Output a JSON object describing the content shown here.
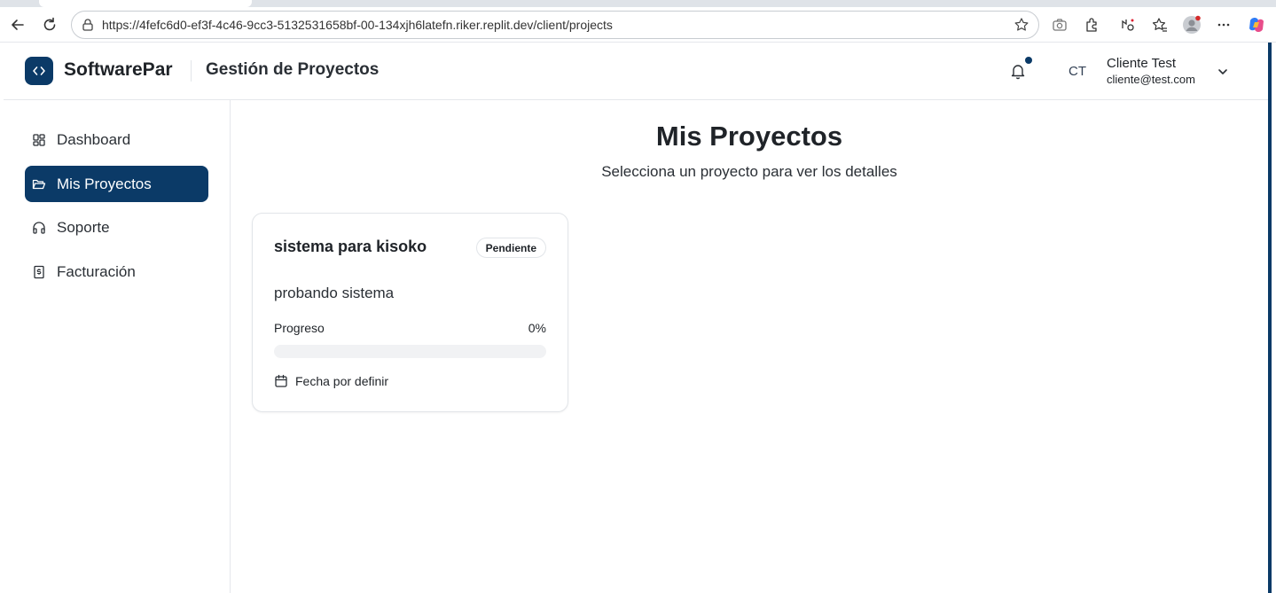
{
  "browser": {
    "url": "https://4fefc6d0-ef3f-4c46-9cc3-5132531658bf-00-134xjh6latefn.riker.replit.dev/client/projects"
  },
  "header": {
    "brand": "SoftwarePar",
    "section_title": "Gestión de Proyectos",
    "avatar_initials": "CT",
    "user_name": "Cliente Test",
    "user_email": "cliente@test.com"
  },
  "sidebar": {
    "items": [
      {
        "label": "Dashboard",
        "icon": "grid-icon",
        "active": false
      },
      {
        "label": "Mis Proyectos",
        "icon": "folder-icon",
        "active": true
      },
      {
        "label": "Soporte",
        "icon": "headphones-icon",
        "active": false
      },
      {
        "label": "Facturación",
        "icon": "receipt-icon",
        "active": false
      }
    ]
  },
  "main": {
    "title": "Mis Proyectos",
    "subtitle": "Selecciona un proyecto para ver los detalles",
    "projects": [
      {
        "name": "sistema para kisoko",
        "status": "Pendiente",
        "description": "probando sistema",
        "progress_label": "Progreso",
        "progress_text": "0%",
        "progress": 0,
        "date": "Fecha por definir"
      }
    ]
  },
  "colors": {
    "brand": "#0b3a67",
    "track": "#f1f2f4"
  }
}
